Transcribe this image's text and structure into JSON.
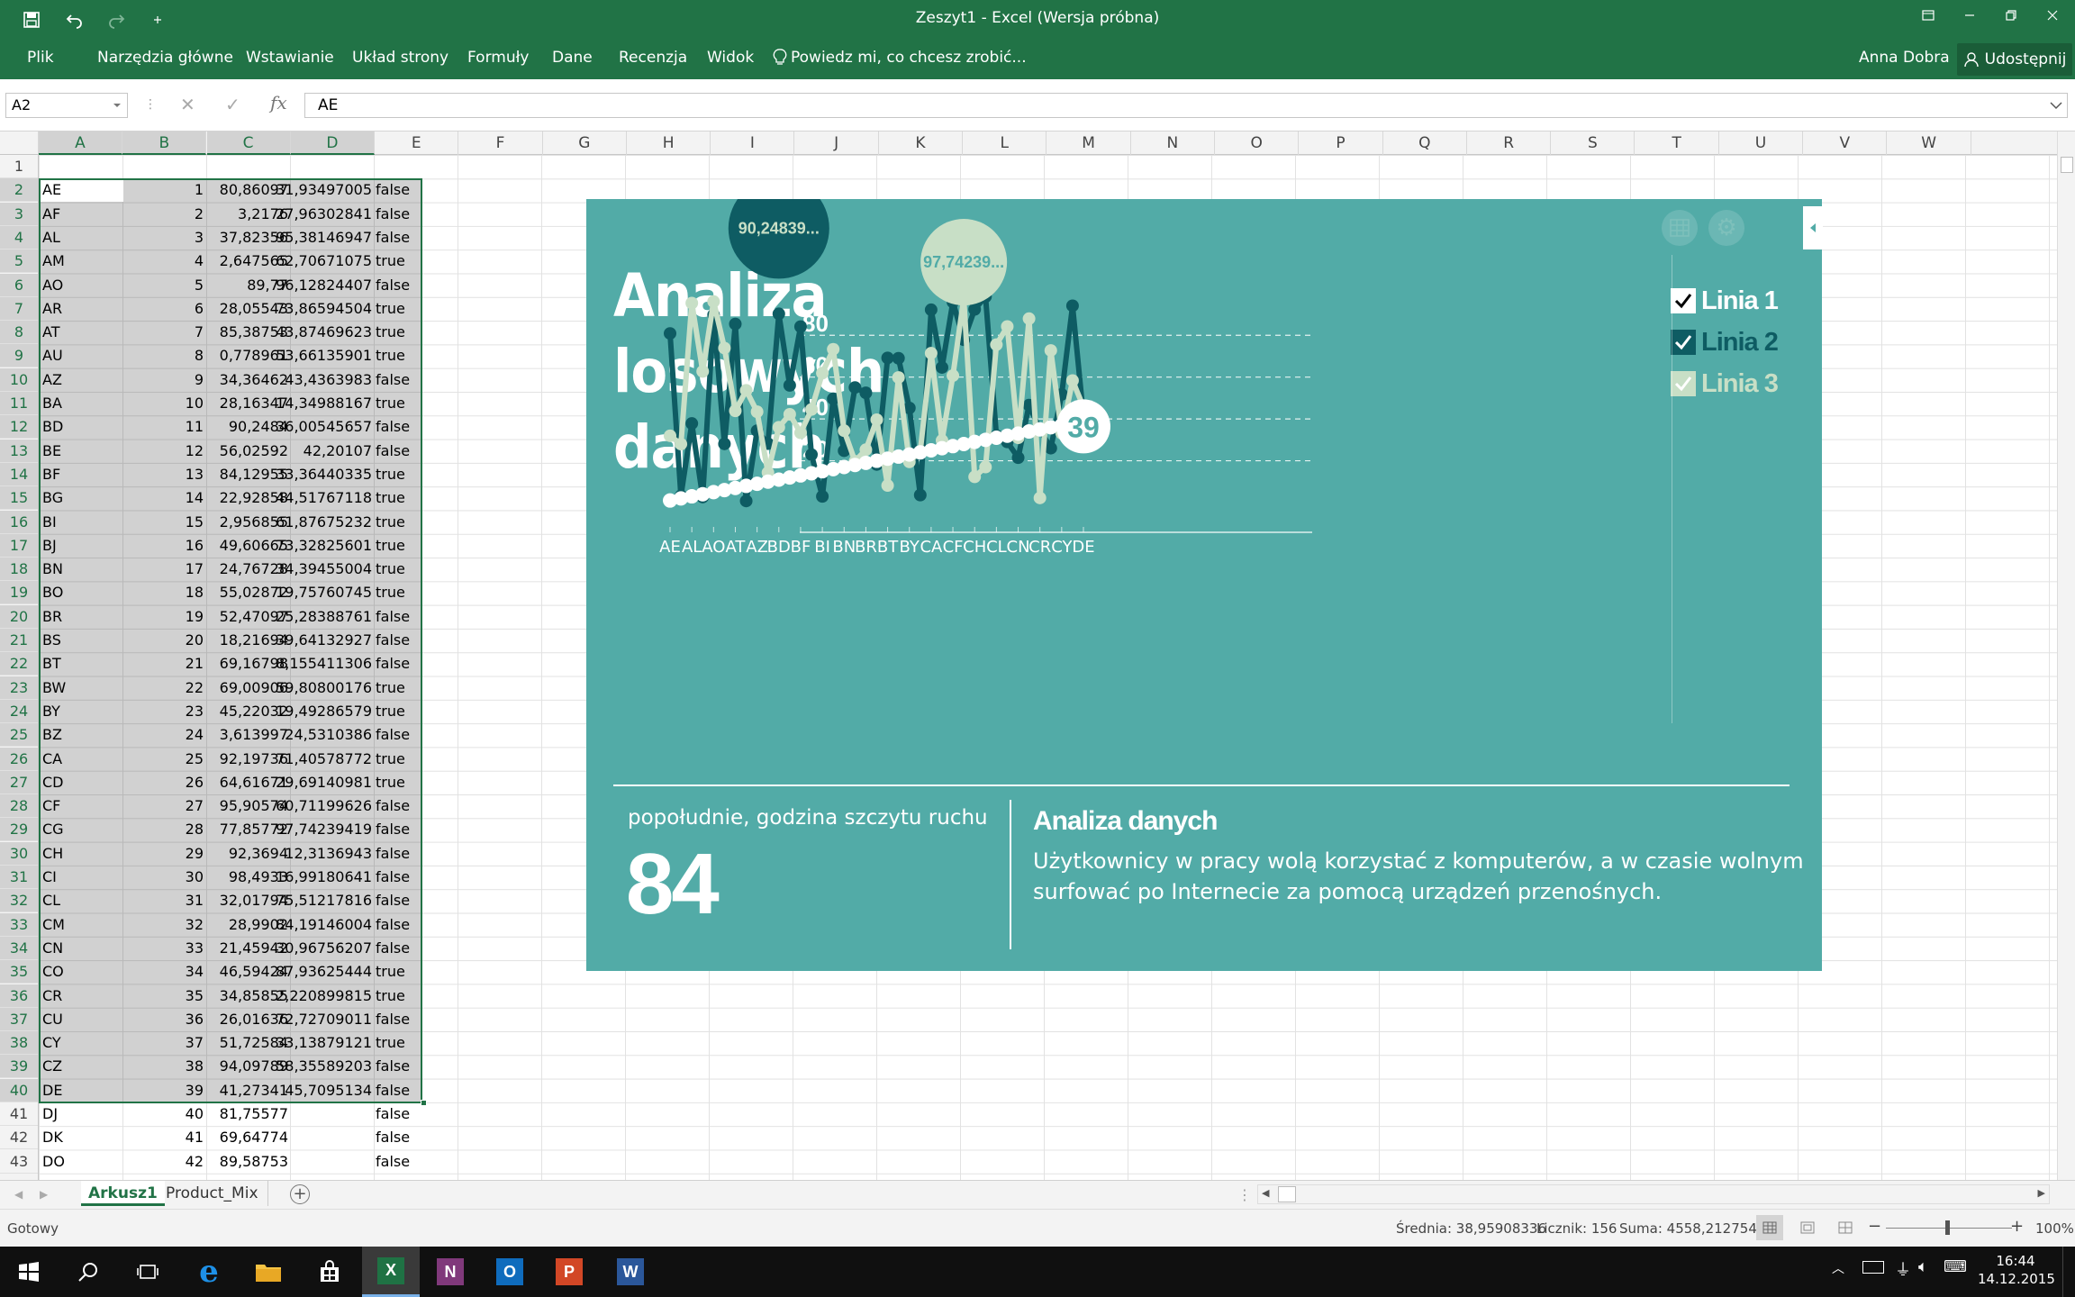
{
  "window": {
    "title": "Zeszyt1 - Excel (Wersja próbna)"
  },
  "ribbon": {
    "tabs": [
      "Plik",
      "Narzędzia główne",
      "Wstawianie",
      "Układ strony",
      "Formuły",
      "Dane",
      "Recenzja",
      "Widok"
    ],
    "tell_me": "Powiedz mi, co chcesz zrobić...",
    "user": "Anna Dobra",
    "share": "Udostępnij"
  },
  "formula_bar": {
    "name_box": "A2",
    "fx": "fx",
    "value": "AE"
  },
  "columns": [
    "A",
    "B",
    "C",
    "D",
    "E",
    "F",
    "G",
    "H",
    "I",
    "J",
    "K",
    "L",
    "M",
    "N",
    "O",
    "P",
    "Q",
    "R",
    "S",
    "T",
    "U",
    "V",
    "W"
  ],
  "rows": [
    [
      "AE",
      "1",
      "80,86097",
      "31,93497005",
      "false"
    ],
    [
      "AF",
      "2",
      "3,2176",
      "27,96302841",
      "false"
    ],
    [
      "AL",
      "3",
      "37,82356",
      "95,38146947",
      "false"
    ],
    [
      "AM",
      "4",
      "2,647565",
      "62,70671075",
      "true"
    ],
    [
      "AO",
      "5",
      "89,77",
      "96,12824407",
      "false"
    ],
    [
      "AR",
      "6",
      "28,05543",
      "73,86594504",
      "true"
    ],
    [
      "AT",
      "7",
      "85,38753",
      "43,87469623",
      "true"
    ],
    [
      "AU",
      "8",
      "0,778961",
      "53,66135901",
      "true"
    ],
    [
      "AZ",
      "9",
      "34,36462",
      "43,4363983",
      "false"
    ],
    [
      "BA",
      "10",
      "28,16347",
      "14,34988167",
      "true"
    ],
    [
      "BD",
      "11",
      "90,2484",
      "36,00545657",
      "false"
    ],
    [
      "BE",
      "12",
      "56,02592",
      "42,20107",
      "false"
    ],
    [
      "BF",
      "13",
      "84,12955",
      "33,36440335",
      "true"
    ],
    [
      "BG",
      "14",
      "22,92858",
      "44,51767118",
      "true"
    ],
    [
      "BI",
      "15",
      "2,956855",
      "61,87675232",
      "true"
    ],
    [
      "BJ",
      "16",
      "49,60665",
      "73,32825601",
      "true"
    ],
    [
      "BN",
      "17",
      "24,76728",
      "34,39455004",
      "true"
    ],
    [
      "BO",
      "18",
      "55,02872",
      "19,75760745",
      "true"
    ],
    [
      "BR",
      "19",
      "52,47097",
      "25,28388761",
      "false"
    ],
    [
      "BS",
      "20",
      "18,21694",
      "39,64132927",
      "false"
    ],
    [
      "BT",
      "21",
      "69,16798",
      "8,155411306",
      "false"
    ],
    [
      "BW",
      "22",
      "69,00906",
      "59,80800176",
      "true"
    ],
    [
      "BY",
      "23",
      "45,22032",
      "19,49286579",
      "true"
    ],
    [
      "BZ",
      "24",
      "3,613997",
      "24,5310386",
      "false"
    ],
    [
      "CA",
      "25",
      "92,19736",
      "71,40578772",
      "true"
    ],
    [
      "CD",
      "26",
      "64,61671",
      "29,69140981",
      "true"
    ],
    [
      "CF",
      "27",
      "95,90574",
      "60,71199626",
      "false"
    ],
    [
      "CG",
      "28",
      "77,85772",
      "97,74239419",
      "false"
    ],
    [
      "CH",
      "29",
      "92,3694",
      "12,3136943",
      "false"
    ],
    [
      "CI",
      "30",
      "98,4933",
      "16,99180641",
      "false"
    ],
    [
      "CL",
      "31",
      "32,01794",
      "75,51217816",
      "false"
    ],
    [
      "CM",
      "32",
      "28,9902",
      "84,19146004",
      "false"
    ],
    [
      "CN",
      "33",
      "21,45942",
      "30,96756207",
      "false"
    ],
    [
      "CO",
      "34",
      "46,59424",
      "87,93625444",
      "true"
    ],
    [
      "CR",
      "35",
      "34,85855",
      "2,220899815",
      "true"
    ],
    [
      "CU",
      "36",
      "26,01636",
      "72,72709011",
      "false"
    ],
    [
      "CY",
      "37",
      "51,72584",
      "33,13879121",
      "true"
    ],
    [
      "CZ",
      "38",
      "94,09789",
      "58,35589203",
      "false"
    ],
    [
      "DE",
      "39",
      "41,27341",
      "45,7095134",
      "false"
    ],
    [
      "DJ",
      "40",
      "81,75577",
      "",
      "false"
    ],
    [
      "DK",
      "41",
      "69,64774",
      "",
      "false"
    ],
    [
      "DO",
      "42",
      "89,58753",
      "",
      "false"
    ]
  ],
  "card": {
    "title_lines": [
      "Analiza",
      "losowych",
      "danych"
    ],
    "legend": [
      {
        "label": "Linia 1",
        "color": "#ffffff"
      },
      {
        "label": "Linia 2",
        "color": "#0e5c63"
      },
      {
        "label": "Linia 3",
        "color": "#c8dfc6"
      }
    ],
    "callouts": [
      "90,24839...",
      "97,74239...",
      "39"
    ],
    "kpi_caption": "popołudnie, godzina szczytu ruchu",
    "kpi_value": "84",
    "analysis_title": "Analiza danych",
    "analysis_text_1": "Użytkownicy w pracy wolą korzystać z komputerów, a w czasie wolnym",
    "analysis_text_2": "surfować po Internecie za pomocą urządzeń przenośnych."
  },
  "chart_data": {
    "type": "line",
    "categories": [
      "AE",
      "AF",
      "AL",
      "AM",
      "AO",
      "AR",
      "AT",
      "AU",
      "AZ",
      "BA",
      "BD",
      "BE",
      "BF",
      "BG",
      "BI",
      "BJ",
      "BN",
      "BO",
      "BR",
      "BS",
      "BT",
      "BW",
      "BY",
      "BZ",
      "CA",
      "CD",
      "CF",
      "CG",
      "CH",
      "CI",
      "CL",
      "CM",
      "CN",
      "CO",
      "CR",
      "CU",
      "CY",
      "CZ",
      "DE"
    ],
    "tick_labels": [
      "AE",
      "AL",
      "AO",
      "AT",
      "AZ",
      "BD",
      "BF",
      "BI",
      "BN",
      "BR",
      "BT",
      "BY",
      "CA",
      "CF",
      "CH",
      "CL",
      "CN",
      "CR",
      "CY",
      "DE"
    ],
    "yticks": [
      20,
      40,
      60,
      80
    ],
    "ylim": [
      0,
      100
    ],
    "grid": true,
    "legend_position": "right",
    "series": [
      {
        "name": "Linia 1",
        "color": "#ffffff",
        "values": [
          1,
          2,
          3,
          4,
          5,
          6,
          7,
          8,
          9,
          10,
          11,
          12,
          13,
          14,
          15,
          16,
          17,
          18,
          19,
          20,
          21,
          22,
          23,
          24,
          25,
          26,
          27,
          28,
          29,
          30,
          31,
          32,
          33,
          34,
          35,
          36,
          37,
          38,
          39
        ]
      },
      {
        "name": "Linia 2",
        "color": "#0e5c63",
        "values": [
          80.86,
          3.22,
          37.82,
          2.65,
          89.77,
          28.06,
          85.39,
          0.78,
          34.36,
          28.16,
          90.25,
          56.03,
          84.13,
          22.93,
          2.96,
          49.61,
          24.77,
          55.03,
          52.47,
          18.22,
          69.17,
          69.01,
          45.22,
          3.61,
          92.2,
          64.62,
          95.91,
          77.86,
          92.37,
          98.49,
          32.02,
          28.99,
          21.46,
          46.59,
          34.86,
          26.02,
          51.73,
          94.1,
          41.27
        ]
      },
      {
        "name": "Linia 3",
        "color": "#c8dfc6",
        "values": [
          31.93,
          27.96,
          95.38,
          62.71,
          96.13,
          73.87,
          43.87,
          53.66,
          43.44,
          14.35,
          36.01,
          42.2,
          33.36,
          44.52,
          61.88,
          73.33,
          34.39,
          19.76,
          25.28,
          39.64,
          8.16,
          59.81,
          19.49,
          24.53,
          71.41,
          29.69,
          60.71,
          97.74,
          12.31,
          16.99,
          75.51,
          84.19,
          30.97,
          87.94,
          2.22,
          72.73,
          33.14,
          58.36,
          45.71
        ]
      }
    ]
  },
  "sheets": [
    "Arkusz1",
    "Product_Mix"
  ],
  "status": {
    "ready": "Gotowy",
    "average": "Średnia: 38,95908336",
    "count": "Licznik: 156",
    "sum": "Suma: 4558,212754",
    "zoom": "100%"
  },
  "taskbar": {
    "time": "16:44",
    "date": "14.12.2015"
  }
}
